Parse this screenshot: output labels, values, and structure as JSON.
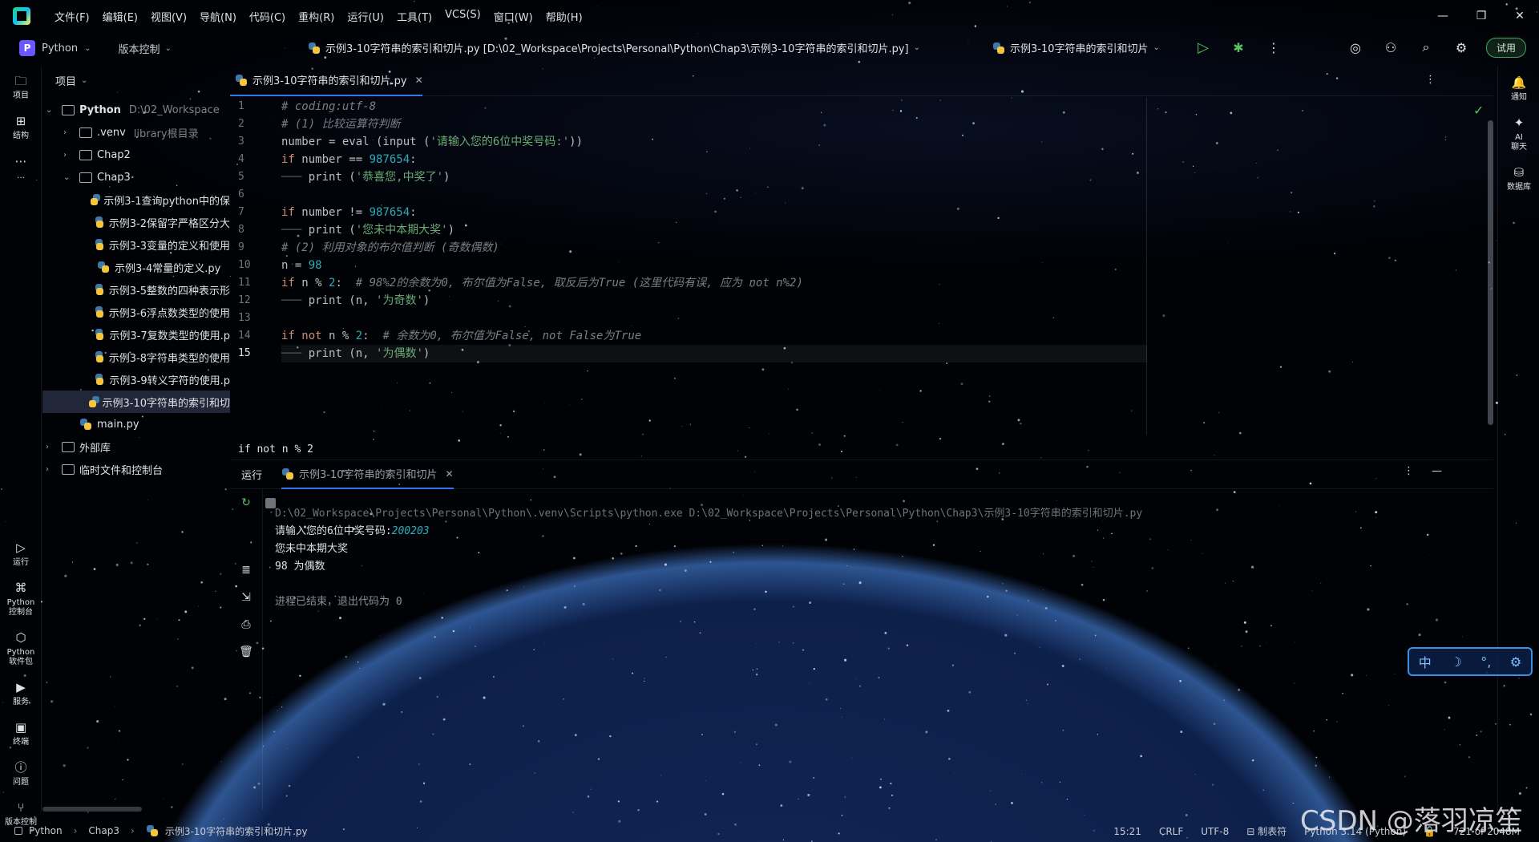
{
  "menu": [
    "文件(F)",
    "编辑(E)",
    "视图(V)",
    "导航(N)",
    "代码(C)",
    "重构(R)",
    "运行(U)",
    "工具(T)",
    "VCS(S)",
    "窗口(W)",
    "帮助(H)"
  ],
  "toolbar": {
    "project_badge": "P",
    "project_name": "Python",
    "vcs_label": "版本控制",
    "file_title": "示例3-10字符串的索引和切片.py [D:\\02_Workspace\\Projects\\Personal\\Python\\Chap3\\示例3-10字符串的索引和切片.py]",
    "run_config": "示例3-10字符串的索引和切片",
    "trial_label": "试用"
  },
  "left_stripe": {
    "top": [
      {
        "icon": "folder-icon",
        "label": "项目"
      },
      {
        "icon": "structure-icon",
        "label": "结构"
      },
      {
        "icon": "more-icon",
        "label": "…"
      }
    ],
    "bottom": [
      {
        "icon": "run-icon",
        "label": "运行"
      },
      {
        "icon": "python-console-icon",
        "label": "Python\n控制台"
      },
      {
        "icon": "python-packages-icon",
        "label": "Python\n软件包"
      },
      {
        "icon": "services-icon",
        "label": "服务"
      },
      {
        "icon": "terminal-icon",
        "label": "终端"
      },
      {
        "icon": "problems-icon",
        "label": "问题"
      },
      {
        "icon": "vcs-icon",
        "label": "版本控制"
      }
    ]
  },
  "right_stripe": [
    {
      "icon": "notifications-icon",
      "label": "通知"
    },
    {
      "icon": "ai-chat-icon",
      "label": "AI\n聊天"
    },
    {
      "icon": "database-icon",
      "label": "数据库"
    }
  ],
  "project_panel": {
    "title": "项目",
    "tree": [
      {
        "indent": 0,
        "type": "folder",
        "open": true,
        "name": "Python",
        "extra": "D:\\02_Workspace",
        "bold": true
      },
      {
        "indent": 1,
        "type": "folder",
        "open": false,
        "name": ".venv",
        "extra": "library根目录"
      },
      {
        "indent": 1,
        "type": "folder",
        "open": false,
        "name": "Chap2",
        "extra": ""
      },
      {
        "indent": 1,
        "type": "folder",
        "open": true,
        "name": "Chap3",
        "extra": ""
      },
      {
        "indent": 2,
        "type": "py",
        "name": "示例3-1查询python中的保",
        "extra": ""
      },
      {
        "indent": 2,
        "type": "py",
        "name": "示例3-2保留字严格区分大",
        "extra": ""
      },
      {
        "indent": 2,
        "type": "py",
        "name": "示例3-3变量的定义和使用",
        "extra": ""
      },
      {
        "indent": 2,
        "type": "py",
        "name": "示例3-4常量的定义.py",
        "extra": ""
      },
      {
        "indent": 2,
        "type": "py",
        "name": "示例3-5整数的四种表示形",
        "extra": ""
      },
      {
        "indent": 2,
        "type": "py",
        "name": "示例3-6浮点数类型的使用",
        "extra": ""
      },
      {
        "indent": 2,
        "type": "py",
        "name": "示例3-7复数类型的使用.p",
        "extra": ""
      },
      {
        "indent": 2,
        "type": "py",
        "name": "示例3-8字符串类型的使用",
        "extra": ""
      },
      {
        "indent": 2,
        "type": "py",
        "name": "示例3-9转义字符的使用.p",
        "extra": ""
      },
      {
        "indent": 2,
        "type": "py",
        "name": "示例3-10字符串的索引和切",
        "extra": "",
        "selected": true
      },
      {
        "indent": 1,
        "type": "py",
        "name": "main.py",
        "extra": ""
      },
      {
        "indent": 0,
        "type": "lib",
        "open": false,
        "name": "外部库",
        "extra": ""
      },
      {
        "indent": 0,
        "type": "scratch",
        "open": false,
        "name": "临时文件和控制台",
        "extra": ""
      }
    ]
  },
  "editor": {
    "tab_label": "示例3-10字符串的索引和切片.py",
    "breadcrumb": "if not n % 2",
    "current_line": 15,
    "lines": [
      [
        [
          "cm",
          "# coding:utf-8"
        ]
      ],
      [
        [
          "cm",
          "# (1) 比较运算符判断"
        ]
      ],
      [
        [
          "fn",
          "number = eval (input ("
        ],
        [
          "str",
          "'请输入您的6位中奖号码:'"
        ],
        [
          "fn",
          "))"
        ]
      ],
      [
        [
          "kw",
          "if"
        ],
        [
          "fn",
          " number == "
        ],
        [
          "num",
          "987654"
        ],
        [
          "fn",
          ":"
        ]
      ],
      [
        [
          "indent",
          "───"
        ],
        [
          "fn",
          " print ("
        ],
        [
          "str",
          "'恭喜您,中奖了'"
        ],
        [
          "fn",
          ")"
        ]
      ],
      [],
      [
        [
          "kw",
          "if"
        ],
        [
          "fn",
          " number != "
        ],
        [
          "num",
          "987654"
        ],
        [
          "fn",
          ":"
        ]
      ],
      [
        [
          "indent",
          "───"
        ],
        [
          "fn",
          " print ("
        ],
        [
          "str",
          "'您未中本期大奖'"
        ],
        [
          "fn",
          ")"
        ]
      ],
      [
        [
          "cm",
          "# (2) 利用对象的布尔值判断 (奇数偶数)"
        ]
      ],
      [
        [
          "fn",
          "n = "
        ],
        [
          "num",
          "98"
        ]
      ],
      [
        [
          "kw",
          "if"
        ],
        [
          "fn",
          " n % "
        ],
        [
          "num",
          "2"
        ],
        [
          "fn",
          ":  "
        ],
        [
          "cm",
          "# 98%2的余数为0, 布尔值为False, 取反后为True (这里代码有误, 应为 not n%2)"
        ]
      ],
      [
        [
          "indent",
          "───"
        ],
        [
          "fn",
          " print (n, "
        ],
        [
          "str",
          "'为奇数'"
        ],
        [
          "fn",
          ")"
        ]
      ],
      [],
      [
        [
          "kw",
          "if not"
        ],
        [
          "fn",
          " n % "
        ],
        [
          "num",
          "2"
        ],
        [
          "fn",
          ":  "
        ],
        [
          "cm",
          "# 余数为0, 布尔值为False, not False为True"
        ]
      ],
      [
        [
          "indent",
          "───"
        ],
        [
          "fn",
          " print (n, "
        ],
        [
          "str",
          "'为偶数'"
        ],
        [
          "fn",
          ")"
        ]
      ]
    ]
  },
  "run_panel": {
    "label": "运行",
    "tab": "示例3-10字符串的索引和切片",
    "console": {
      "command": "D:\\02_Workspace\\Projects\\Personal\\Python\\.venv\\Scripts\\python.exe D:\\02_Workspace\\Projects\\Personal\\Python\\Chap3\\示例3-10字符串的索引和切片.py",
      "prompt": "请输入您的6位中奖号码:",
      "input": "200203",
      "out1": "您未中本期大奖",
      "out2": "98 为偶数",
      "exit": "进程已结束，退出代码为 0"
    }
  },
  "ime": {
    "lang": "中",
    "moon": "☽",
    "punct": "°,",
    "settings": "⚙"
  },
  "statusbar": {
    "breadcrumb": [
      "Python",
      "Chap3",
      "示例3-10字符串的索引和切片.py"
    ],
    "position": "15:21",
    "line_sep": "CRLF",
    "encoding": "UTF-8",
    "indent": "制表符",
    "interpreter": "Python 3.14 (Python)",
    "memory": "721 of 2048M"
  },
  "watermark": "CSDN @落羽凉笙"
}
